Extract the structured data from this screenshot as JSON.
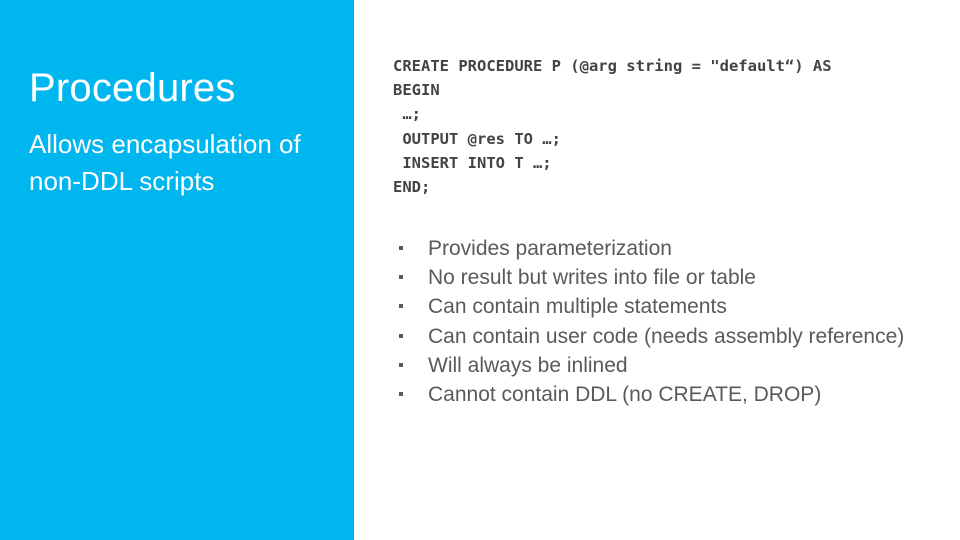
{
  "slide": {
    "accent_color": "#00b6ef",
    "background_color": "#fffffe",
    "text_color": "#5a5a5a",
    "code_color": "#434343"
  },
  "left_panel": {
    "title": "Procedures",
    "subtitle": "Allows encapsulation of non-DDL scripts"
  },
  "code": {
    "language": "sql",
    "lines": [
      "CREATE PROCEDURE P (@arg string = \"default“) AS",
      "BEGIN",
      " …;",
      " OUTPUT @res TO …;",
      " INSERT INTO T …;",
      "END;"
    ]
  },
  "bullets": {
    "glyph": "square-bullet-icon",
    "items": [
      "Provides parameterization",
      "No result but writes into file or table",
      "Can contain multiple statements",
      "Can contain user code (needs assembly reference)",
      "Will always be inlined",
      "Cannot contain DDL (no CREATE, DROP)"
    ]
  }
}
